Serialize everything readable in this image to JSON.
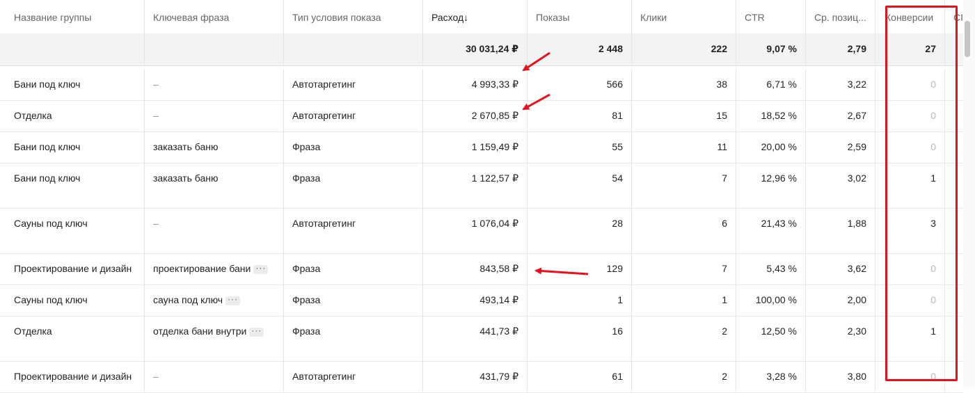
{
  "columns": [
    {
      "label": "Название группы"
    },
    {
      "label": "Ключевая фраза"
    },
    {
      "label": "Тип условия показа"
    },
    {
      "label": "Расход",
      "sort_icon": "↓"
    },
    {
      "label": "Показы"
    },
    {
      "label": "Клики"
    },
    {
      "label": "CTR"
    },
    {
      "label": "Ср. позиц..."
    },
    {
      "label": "Конверсии"
    },
    {
      "label": "CI"
    }
  ],
  "totals": {
    "spend": "30 031,24 ₽",
    "impressions": "2 448",
    "clicks": "222",
    "ctr": "9,07 %",
    "avg_pos": "2,79",
    "conversions": "27"
  },
  "rows": [
    {
      "group": "Бани под ключ",
      "phrase": "–",
      "type": "Автотаргетинг",
      "spend": "4 993,33 ₽",
      "impressions": "566",
      "clicks": "38",
      "ctr": "6,71 %",
      "avg_pos": "3,22",
      "conversions": "0"
    },
    {
      "group": "Отделка",
      "phrase": "–",
      "type": "Автотаргетинг",
      "spend": "2 670,85 ₽",
      "impressions": "81",
      "clicks": "15",
      "ctr": "18,52 %",
      "avg_pos": "2,67",
      "conversions": "0"
    },
    {
      "group": "Бани под ключ",
      "phrase": "заказать баню",
      "type": "Фраза",
      "spend": "1 159,49 ₽",
      "impressions": "55",
      "clicks": "11",
      "ctr": "20,00 %",
      "avg_pos": "2,59",
      "conversions": "0"
    },
    {
      "group": "Бани под ключ",
      "phrase": "заказать баню",
      "type": "Фраза",
      "spend": "1 122,57 ₽",
      "impressions": "54",
      "clicks": "7",
      "ctr": "12,96 %",
      "avg_pos": "3,02",
      "conversions": "1"
    },
    {
      "group": "Сауны под ключ",
      "phrase": "–",
      "type": "Автотаргетинг",
      "spend": "1 076,04 ₽",
      "impressions": "28",
      "clicks": "6",
      "ctr": "21,43 %",
      "avg_pos": "1,88",
      "conversions": "3"
    },
    {
      "group": "Проектирование и дизайн",
      "phrase": "проектирование бани",
      "phrase_more": "···",
      "type": "Фраза",
      "spend": "843,58 ₽",
      "impressions": "129",
      "clicks": "7",
      "ctr": "5,43 %",
      "avg_pos": "3,62",
      "conversions": "0"
    },
    {
      "group": "Сауны под ключ",
      "phrase": "сауна под ключ",
      "phrase_more": "···",
      "type": "Фраза",
      "spend": "493,14 ₽",
      "impressions": "1",
      "clicks": "1",
      "ctr": "100,00 %",
      "avg_pos": "2,00",
      "conversions": "0"
    },
    {
      "group": "Отделка",
      "phrase": "отделка бани внутри",
      "phrase_more": "···",
      "type": "Фраза",
      "spend": "441,73 ₽",
      "impressions": "16",
      "clicks": "2",
      "ctr": "12,50 %",
      "avg_pos": "2,30",
      "conversions": "1"
    },
    {
      "group": "Проектирование и дизайн",
      "phrase": "–",
      "type": "Автотаргетинг",
      "spend": "431,79 ₽",
      "impressions": "61",
      "clicks": "2",
      "ctr": "3,28 %",
      "avg_pos": "3,80",
      "conversions": "0"
    }
  ],
  "colors": {
    "annotation": "#e3131b",
    "total_row_bg": "#f1f3f5"
  }
}
